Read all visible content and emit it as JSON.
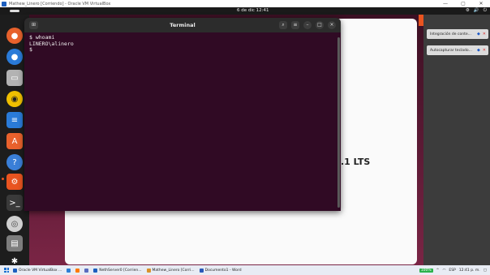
{
  "vbox": {
    "title": "Mathew_Linero [Corriendo] - Oracle VM VirtualBox",
    "minimize": "—",
    "maximize": "▢",
    "close": "✕"
  },
  "ubuntu": {
    "clock": "6 de dic  12:41",
    "tray": [
      "⚙",
      "🔊",
      "⏻"
    ]
  },
  "background_window": {
    "text": ".1 LTS"
  },
  "terminal": {
    "title": "Terminal",
    "lines": [
      "$ whoami",
      "LINERO\\alinero",
      "$"
    ]
  },
  "side_panel": {
    "notifications": [
      {
        "label": "Integración de conte..."
      },
      {
        "label": "Autocapturar teclado..."
      }
    ]
  },
  "taskbar": {
    "items": [
      {
        "label": "Oracle VM VirtualBox ...",
        "color": "#1d5fbf"
      },
      {
        "label": "",
        "color": "#2d7fd6"
      },
      {
        "label": "",
        "color": "#ff7a00"
      },
      {
        "label": "",
        "color": "#5a6cbf"
      },
      {
        "label": "NethServer0 [Corrien...",
        "color": "#1d5fbf"
      },
      {
        "label": "Mathew_Linero [Corri...",
        "color": "#d8922b"
      },
      {
        "label": "Documento1 - Word",
        "color": "#2b5ab9"
      }
    ],
    "battery": "100%",
    "lang": "ESP",
    "time": "12:41 p. m."
  }
}
